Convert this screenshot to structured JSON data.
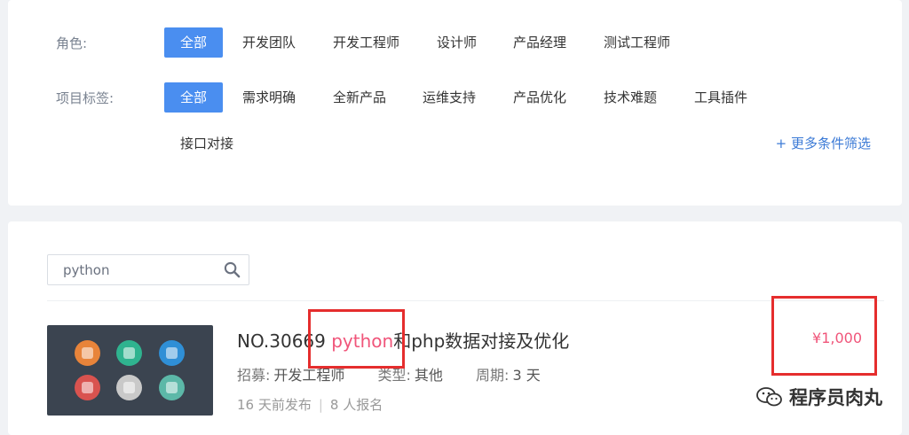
{
  "filters": {
    "role": {
      "label": "角色:",
      "options": [
        "全部",
        "开发团队",
        "开发工程师",
        "设计师",
        "产品经理",
        "测试工程师"
      ]
    },
    "tags": {
      "label": "项目标签:",
      "options": [
        "全部",
        "需求明确",
        "全新产品",
        "运维支持",
        "产品优化",
        "技术难题",
        "工具插件",
        "接口对接"
      ]
    },
    "more_label": "+ 更多条件筛选"
  },
  "search": {
    "value": "python"
  },
  "project": {
    "number": "NO.30669",
    "title_highlight": "python",
    "title_rest": "和php数据对接及优化",
    "recruit_key": "招募:",
    "recruit_value": "开发工程师",
    "type_key": "类型:",
    "type_value": "其他",
    "period_key": "周期:",
    "period_value": "3 天",
    "published": "16 天前发布",
    "separator": "|",
    "signups": "8 人报名",
    "price": "¥1,000"
  },
  "thumbnail_icons": [
    {
      "name": "bug-icon",
      "color": "#e8843a"
    },
    {
      "name": "compass-icon",
      "color": "#2fb38f"
    },
    {
      "name": "windows-icon",
      "color": "#2f8fd6"
    },
    {
      "name": "browser-icon",
      "color": "#d9534f"
    },
    {
      "name": "link-icon",
      "color": "#c9c9c9"
    },
    {
      "name": "more-icon",
      "color": "#5cb8a8"
    }
  ],
  "watermark": {
    "text": "程序员肉丸"
  },
  "colors": {
    "accent": "#4a8ef0",
    "highlight": "#f0557a",
    "annotation": "#e52d2d"
  }
}
